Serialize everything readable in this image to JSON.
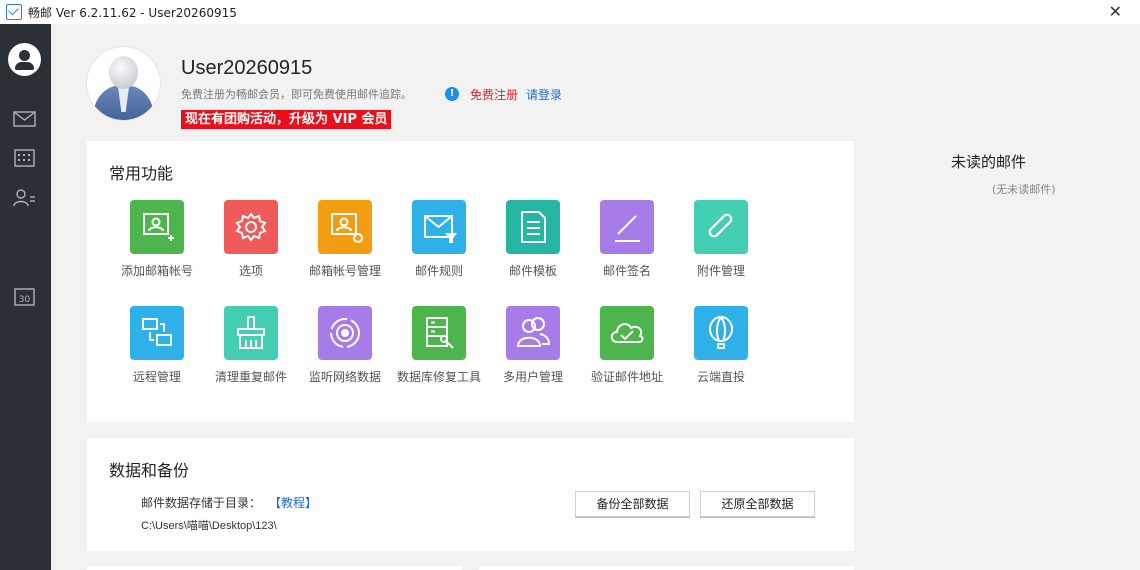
{
  "window": {
    "title": "畅邮 Ver 6.2.11.62  -  User20260915",
    "close_symbol": "✕"
  },
  "sidebar": {
    "items": [
      {
        "icon": "user-icon"
      },
      {
        "icon": "mail-icon"
      },
      {
        "icon": "calendar-grid-icon"
      },
      {
        "icon": "contacts-icon"
      },
      {
        "icon": "calendar-30-icon",
        "text": "30"
      }
    ]
  },
  "profile": {
    "username": "User20260915",
    "subtext": "免费注册为畅邮会员，即可免费使用邮件追踪。",
    "info_symbol": "!",
    "register_link": "免费注册",
    "login_link": "请登录",
    "vip_banner": "现在有团购活动，升级为 VIP 会员"
  },
  "features": {
    "title": "常用功能",
    "items": [
      {
        "label": "添加邮箱帐号",
        "icon": "add-account-icon",
        "color": "#4cb54c"
      },
      {
        "label": "选项",
        "icon": "gear-icon",
        "color": "#ef5a5a"
      },
      {
        "label": "邮箱帐号管理",
        "icon": "account-settings-icon",
        "color": "#f59d12"
      },
      {
        "label": "邮件规则",
        "icon": "mail-filter-icon",
        "color": "#2eb0e8"
      },
      {
        "label": "邮件模板",
        "icon": "document-icon",
        "color": "#26b7a4"
      },
      {
        "label": "邮件签名",
        "icon": "pen-icon",
        "color": "#a77ce8"
      },
      {
        "label": "附件管理",
        "icon": "paperclip-icon",
        "color": "#44cfb3"
      },
      {
        "label": "远程管理",
        "icon": "remote-icon",
        "color": "#2eb0e8"
      },
      {
        "label": "清理重复邮件",
        "icon": "broom-icon",
        "color": "#44cfb3"
      },
      {
        "label": "监听网络数据",
        "icon": "target-icon",
        "color": "#a77ce8"
      },
      {
        "label": "数据库修复工具",
        "icon": "database-repair-icon",
        "color": "#4cb54c"
      },
      {
        "label": "多用户管理",
        "icon": "multi-user-icon",
        "color": "#a77ce8"
      },
      {
        "label": "验证邮件地址",
        "icon": "cloud-check-icon",
        "color": "#4cb54c"
      },
      {
        "label": "云端直投",
        "icon": "balloon-icon",
        "color": "#2eb0e8"
      }
    ]
  },
  "unread": {
    "title": "未读的邮件",
    "empty_text": "(无未读邮件)"
  },
  "backup": {
    "title": "数据和备份",
    "store_label": "邮件数据存储于目录：",
    "tutorial_link": "【教程】",
    "path": "C:\\Users\\喵喵\\Desktop\\123\\",
    "backup_button": "备份全部数据",
    "restore_button": "还原全部数据"
  }
}
